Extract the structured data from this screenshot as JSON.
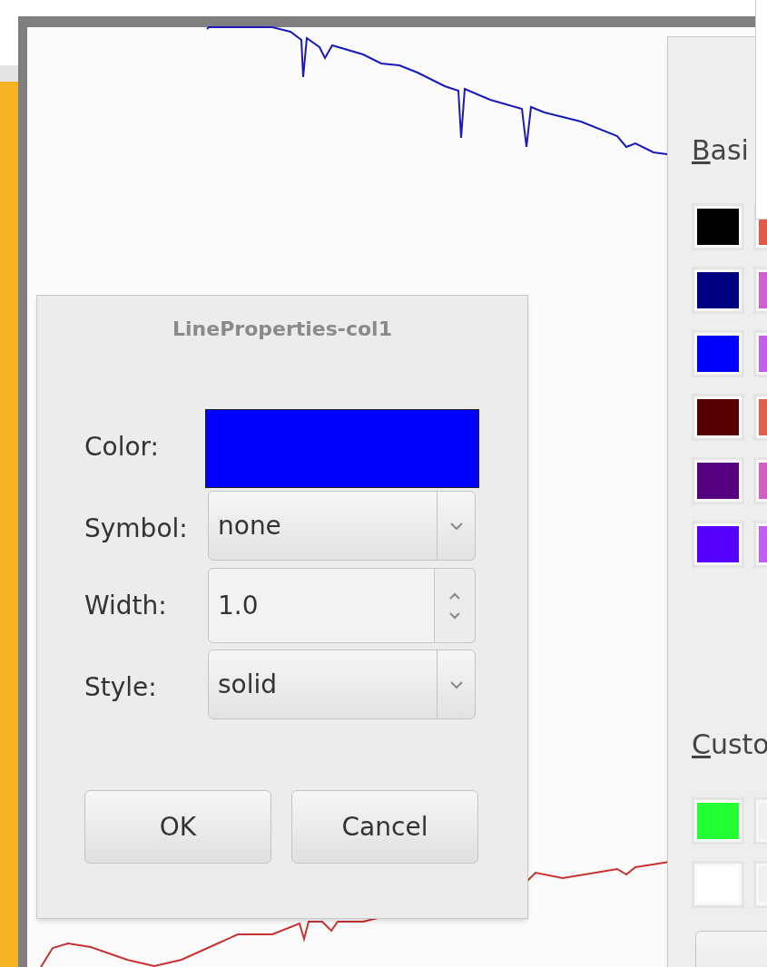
{
  "line_properties_dialog": {
    "title": "LineProperties-col1",
    "fields": [
      {
        "kind": "color",
        "label": "Color:",
        "color": "#0000ff"
      },
      {
        "kind": "combo",
        "label": "Symbol:",
        "value": "none"
      },
      {
        "kind": "spin",
        "label": "Width:",
        "value": "1.0"
      },
      {
        "kind": "combo",
        "label": "Style:",
        "value": "solid"
      }
    ],
    "buttons": [
      "OK",
      "Cancel"
    ]
  },
  "color_dialog": {
    "sections": [
      {
        "label": "Basi",
        "swatches": [
          {
            "color": "#000000"
          },
          {
            "color": "#e05a4a"
          },
          {
            "color": "#000080"
          },
          {
            "color": "#d060d0"
          },
          {
            "color": "#0000ff"
          },
          {
            "color": "#c060e8"
          },
          {
            "color": "#550000"
          },
          {
            "color": "#e06050"
          },
          {
            "color": "#55007f"
          },
          {
            "color": "#d060c0"
          },
          {
            "color": "#5500ff"
          },
          {
            "color": "#c060f0"
          }
        ]
      },
      {
        "label": "Custo",
        "swatches": [
          {
            "color": "#22ff33"
          },
          {
            "color": "#f0f0f0"
          },
          {
            "color": "#ffffff"
          },
          {
            "color": "#f0f0f0"
          }
        ]
      }
    ]
  }
}
